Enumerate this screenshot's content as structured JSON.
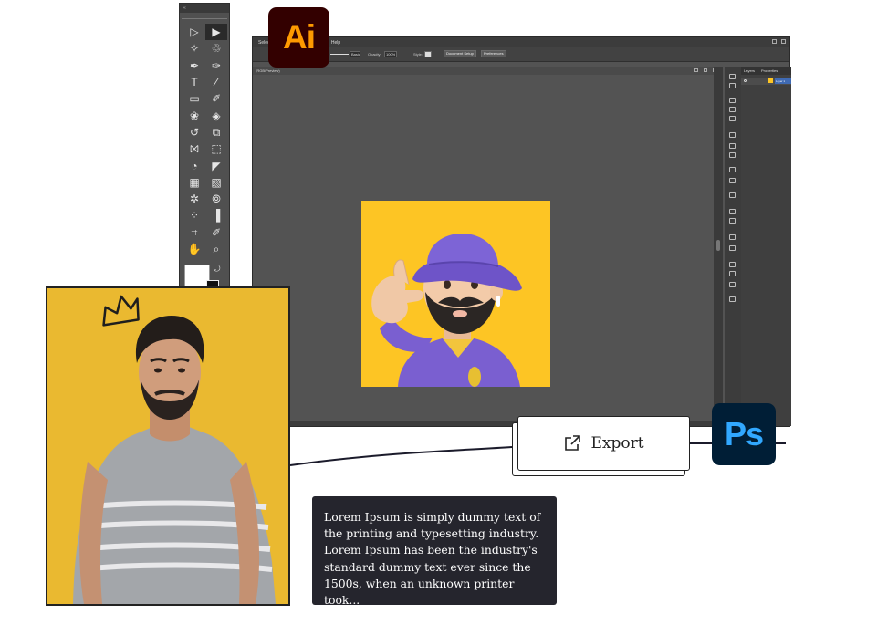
{
  "toolbar": {
    "collapse_label": "«",
    "tools": [
      {
        "name": "selection-tool-icon",
        "glyph": "▷"
      },
      {
        "name": "direct-selection-tool-icon",
        "glyph": "▶"
      },
      {
        "name": "magic-wand-tool-icon",
        "glyph": "✧"
      },
      {
        "name": "lasso-tool-icon",
        "glyph": "♲"
      },
      {
        "name": "pen-tool-icon",
        "glyph": "✒"
      },
      {
        "name": "curvature-tool-icon",
        "glyph": "✑"
      },
      {
        "name": "type-tool-icon",
        "glyph": "T"
      },
      {
        "name": "line-tool-icon",
        "glyph": "∕"
      },
      {
        "name": "rectangle-tool-icon",
        "glyph": "▭"
      },
      {
        "name": "paintbrush-tool-icon",
        "glyph": "✐"
      },
      {
        "name": "shaper-tool-icon",
        "glyph": "❀"
      },
      {
        "name": "eraser-tool-icon",
        "glyph": "◈"
      },
      {
        "name": "rotate-tool-icon",
        "glyph": "↺"
      },
      {
        "name": "scale-tool-icon",
        "glyph": "⧉"
      },
      {
        "name": "width-tool-icon",
        "glyph": "⨝"
      },
      {
        "name": "free-transform-tool-icon",
        "glyph": "⬚"
      },
      {
        "name": "shape-builder-tool-icon",
        "glyph": "◔"
      },
      {
        "name": "perspective-grid-tool-icon",
        "glyph": "◤"
      },
      {
        "name": "mesh-tool-icon",
        "glyph": "▦"
      },
      {
        "name": "gradient-tool-icon",
        "glyph": "▧"
      },
      {
        "name": "eyedropper-tool-icon",
        "glyph": "✲"
      },
      {
        "name": "blend-tool-icon",
        "glyph": "⦾"
      },
      {
        "name": "symbol-sprayer-tool-icon",
        "glyph": "⁘"
      },
      {
        "name": "column-graph-tool-icon",
        "glyph": "▐"
      },
      {
        "name": "artboard-tool-icon",
        "glyph": "⌗"
      },
      {
        "name": "slice-tool-icon",
        "glyph": "✐"
      },
      {
        "name": "hand-tool-icon",
        "glyph": "✋"
      },
      {
        "name": "zoom-tool-icon",
        "glyph": "⌕"
      }
    ]
  },
  "ai_window": {
    "menu_items": [
      "Select",
      "Help"
    ],
    "control_bar": {
      "stroke_style": "Basic",
      "opacity_label": "Opacity:",
      "opacity_value": "100%",
      "style_label": "Style:",
      "document_setup_label": "Document Setup",
      "preferences_label": "Preferences"
    },
    "doc_tab": "(RGB/Preview)",
    "panels": {
      "tab_layers": "Layers",
      "tab_properties": "Properties",
      "layer_name": "Layer 1"
    }
  },
  "logos": {
    "ai": "Ai",
    "ps": "Ps"
  },
  "export": {
    "label": "Export"
  },
  "text_card": {
    "body": "Lorem Ipsum is simply dummy text of the printing and typesetting industry. Lorem Ipsum has been the industry's standard dummy text ever since the 1500s, when an unknown printer took..."
  },
  "colors": {
    "ai_logo_bg": "#330000",
    "ai_logo_fg": "#ff9a00",
    "ps_logo_bg": "#001e36",
    "ps_logo_fg": "#31a8ff",
    "artboard_bg": "#fdc524",
    "photo_bg": "#eab930",
    "ui_dark": "#535353",
    "text_card_bg": "#25252d"
  }
}
